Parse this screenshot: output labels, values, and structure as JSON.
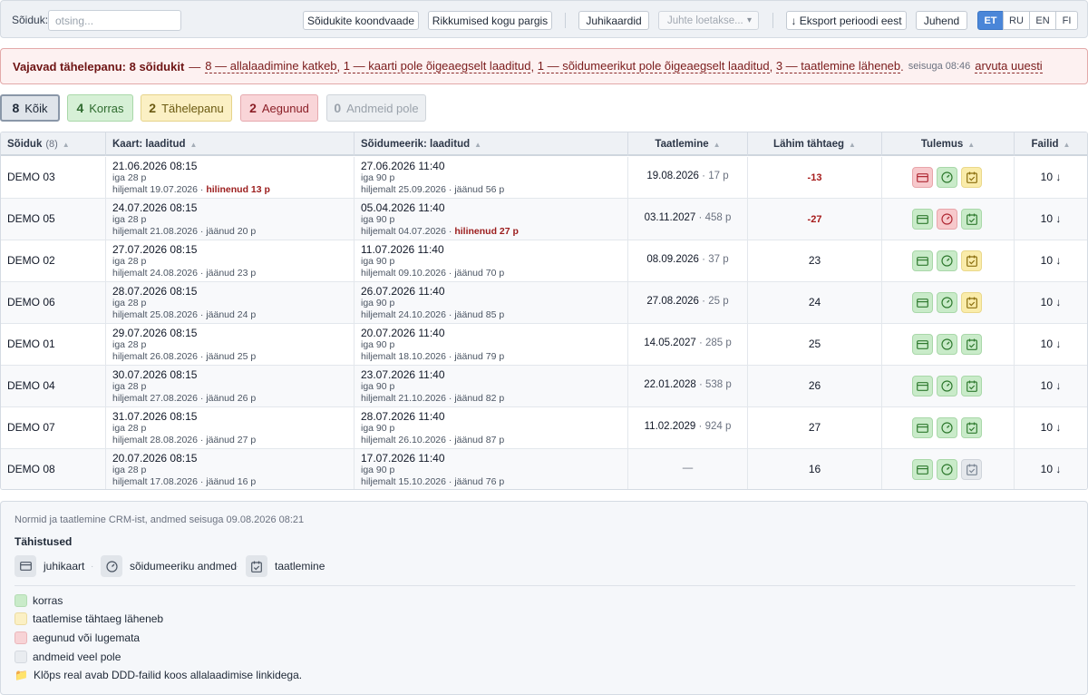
{
  "toolbar": {
    "search_label": "Sõiduk:",
    "search_placeholder": "otsing...",
    "btn_summary": "Sõidukite koondvaade",
    "btn_violations": "Rikkumised kogu pargis",
    "btn_driver_cards": "Juhikaardid",
    "driver_select_placeholder": "Juhte loetakse...",
    "btn_export": "↓ Eksport perioodi eest",
    "btn_guide": "Juhend",
    "languages": [
      "ET",
      "RU",
      "EN",
      "FI"
    ],
    "active_language": "ET"
  },
  "alert": {
    "title": "Vajavad tähelepanu: 8 sõidukit",
    "dash": "—",
    "items": [
      "8 — allalaadimine katkeb",
      "1 — kaarti pole õigeaegselt laaditud",
      "1 — sõidumeerikut pole õigeaegselt laaditud",
      "3 — taatlemine läheneb"
    ],
    "separator": ",",
    "end": ".",
    "as_of": "seisuga 08:46",
    "recalc": "arvuta uuesti"
  },
  "filters": [
    {
      "count": "8",
      "label": "Kõik"
    },
    {
      "count": "4",
      "label": "Korras"
    },
    {
      "count": "2",
      "label": "Tähelepanu"
    },
    {
      "count": "2",
      "label": "Aegunud"
    },
    {
      "count": "0",
      "label": "Andmeid pole"
    }
  ],
  "columns": {
    "vehicle": "Sõiduk",
    "vehicle_count": "(8)",
    "card": "Kaart: laaditud",
    "tacho": "Sõidumeerik: laaditud",
    "calibration": "Taatlemine",
    "deadline": "Lähim tähtaeg",
    "result": "Tulemus",
    "files": "Failid"
  },
  "rows": [
    {
      "vehicle": "DEMO 03",
      "card_date": "21.06.2026 08:15",
      "card_every": "iga 28 p",
      "card_due": "hiljemalt 19.07.2026",
      "card_sep": "·",
      "card_status": "hilinenud 13 p",
      "card_late": true,
      "tacho_date": "27.06.2026 11:40",
      "tacho_every": "iga 90 p",
      "tacho_due": "hiljemalt 25.09.2026",
      "tacho_sep": "·",
      "tacho_status": "jäänud 56 p",
      "tacho_late": false,
      "cal_date": "19.08.2026",
      "cal_sep": "·",
      "cal_days": "17 p",
      "deadline": "-13",
      "deadline_neg": true,
      "icons": [
        "red",
        "green",
        "yellow"
      ],
      "files": "10 ↓"
    },
    {
      "vehicle": "DEMO 05",
      "card_date": "24.07.2026 08:15",
      "card_every": "iga 28 p",
      "card_due": "hiljemalt 21.08.2026",
      "card_sep": "·",
      "card_status": "jäänud 20 p",
      "card_late": false,
      "tacho_date": "05.04.2026 11:40",
      "tacho_every": "iga 90 p",
      "tacho_due": "hiljemalt 04.07.2026",
      "tacho_sep": "·",
      "tacho_status": "hilinenud 27 p",
      "tacho_late": true,
      "cal_date": "03.11.2027",
      "cal_sep": "·",
      "cal_days": "458 p",
      "deadline": "-27",
      "deadline_neg": true,
      "icons": [
        "green",
        "red",
        "green"
      ],
      "files": "10 ↓"
    },
    {
      "vehicle": "DEMO 02",
      "card_date": "27.07.2026 08:15",
      "card_every": "iga 28 p",
      "card_due": "hiljemalt 24.08.2026",
      "card_sep": "·",
      "card_status": "jäänud 23 p",
      "card_late": false,
      "tacho_date": "11.07.2026 11:40",
      "tacho_every": "iga 90 p",
      "tacho_due": "hiljemalt 09.10.2026",
      "tacho_sep": "·",
      "tacho_status": "jäänud 70 p",
      "tacho_late": false,
      "cal_date": "08.09.2026",
      "cal_sep": "·",
      "cal_days": "37 p",
      "deadline": "23",
      "deadline_neg": false,
      "icons": [
        "green",
        "green",
        "yellow"
      ],
      "files": "10 ↓"
    },
    {
      "vehicle": "DEMO 06",
      "card_date": "28.07.2026 08:15",
      "card_every": "iga 28 p",
      "card_due": "hiljemalt 25.08.2026",
      "card_sep": "·",
      "card_status": "jäänud 24 p",
      "card_late": false,
      "tacho_date": "26.07.2026 11:40",
      "tacho_every": "iga 90 p",
      "tacho_due": "hiljemalt 24.10.2026",
      "tacho_sep": "·",
      "tacho_status": "jäänud 85 p",
      "tacho_late": false,
      "cal_date": "27.08.2026",
      "cal_sep": "·",
      "cal_days": "25 p",
      "deadline": "24",
      "deadline_neg": false,
      "icons": [
        "green",
        "green",
        "yellow"
      ],
      "files": "10 ↓"
    },
    {
      "vehicle": "DEMO 01",
      "card_date": "29.07.2026 08:15",
      "card_every": "iga 28 p",
      "card_due": "hiljemalt 26.08.2026",
      "card_sep": "·",
      "card_status": "jäänud 25 p",
      "card_late": false,
      "tacho_date": "20.07.2026 11:40",
      "tacho_every": "iga 90 p",
      "tacho_due": "hiljemalt 18.10.2026",
      "tacho_sep": "·",
      "tacho_status": "jäänud 79 p",
      "tacho_late": false,
      "cal_date": "14.05.2027",
      "cal_sep": "·",
      "cal_days": "285 p",
      "deadline": "25",
      "deadline_neg": false,
      "icons": [
        "green",
        "green",
        "green"
      ],
      "files": "10 ↓"
    },
    {
      "vehicle": "DEMO 04",
      "card_date": "30.07.2026 08:15",
      "card_every": "iga 28 p",
      "card_due": "hiljemalt 27.08.2026",
      "card_sep": "·",
      "card_status": "jäänud 26 p",
      "card_late": false,
      "tacho_date": "23.07.2026 11:40",
      "tacho_every": "iga 90 p",
      "tacho_due": "hiljemalt 21.10.2026",
      "tacho_sep": "·",
      "tacho_status": "jäänud 82 p",
      "tacho_late": false,
      "cal_date": "22.01.2028",
      "cal_sep": "·",
      "cal_days": "538 p",
      "deadline": "26",
      "deadline_neg": false,
      "icons": [
        "green",
        "green",
        "green"
      ],
      "files": "10 ↓"
    },
    {
      "vehicle": "DEMO 07",
      "card_date": "31.07.2026 08:15",
      "card_every": "iga 28 p",
      "card_due": "hiljemalt 28.08.2026",
      "card_sep": "·",
      "card_status": "jäänud 27 p",
      "card_late": false,
      "tacho_date": "28.07.2026 11:40",
      "tacho_every": "iga 90 p",
      "tacho_due": "hiljemalt 26.10.2026",
      "tacho_sep": "·",
      "tacho_status": "jäänud 87 p",
      "tacho_late": false,
      "cal_date": "11.02.2029",
      "cal_sep": "·",
      "cal_days": "924 p",
      "deadline": "27",
      "deadline_neg": false,
      "icons": [
        "green",
        "green",
        "green"
      ],
      "files": "10 ↓"
    },
    {
      "vehicle": "DEMO 08",
      "card_date": "20.07.2026 08:15",
      "card_every": "iga 28 p",
      "card_due": "hiljemalt 17.08.2026",
      "card_sep": "·",
      "card_status": "jäänud 16 p",
      "card_late": false,
      "tacho_date": "17.07.2026 11:40",
      "tacho_every": "iga 90 p",
      "tacho_due": "hiljemalt 15.10.2026",
      "tacho_sep": "·",
      "tacho_status": "jäänud 76 p",
      "tacho_late": false,
      "cal_date": "—",
      "cal_sep": "",
      "cal_days": "",
      "deadline": "16",
      "deadline_neg": false,
      "icons": [
        "green",
        "green",
        "gray"
      ],
      "files": "10 ↓"
    }
  ],
  "footer": {
    "source": "Normid ja taatlemine CRM-ist, andmed seisuga 09.08.2026 08:21",
    "legend_title": "Tähistused",
    "icon_legend": [
      {
        "icon": "card-icon",
        "label": "juhikaart"
      },
      {
        "icon": "gauge-icon",
        "label": "sõidumeeriku andmed"
      },
      {
        "icon": "calendar-check-icon",
        "label": "taatlemine"
      }
    ],
    "icon_sep": "·",
    "color_legend": [
      {
        "color": "#c9ebc9",
        "label": "korras"
      },
      {
        "color": "#fbf0c4",
        "label": "taatlemise tähtaeg läheneb"
      },
      {
        "color": "#f7d3d6",
        "label": "aegunud või lugemata"
      },
      {
        "color": "#e9ecf0",
        "label": "andmeid veel pole"
      }
    ],
    "hint_icon": "📁",
    "hint": "Klõps real avab DDD-failid koos allalaadimise linkidega."
  },
  "colors": {
    "accent": "#4a86d8",
    "alert_bg": "#fdf1f1",
    "late": "#9b1c1c",
    "ok": "#c9ebc9",
    "warn": "#faecaa",
    "bad": "#f7c9cc",
    "none": "#e5e8ec"
  }
}
